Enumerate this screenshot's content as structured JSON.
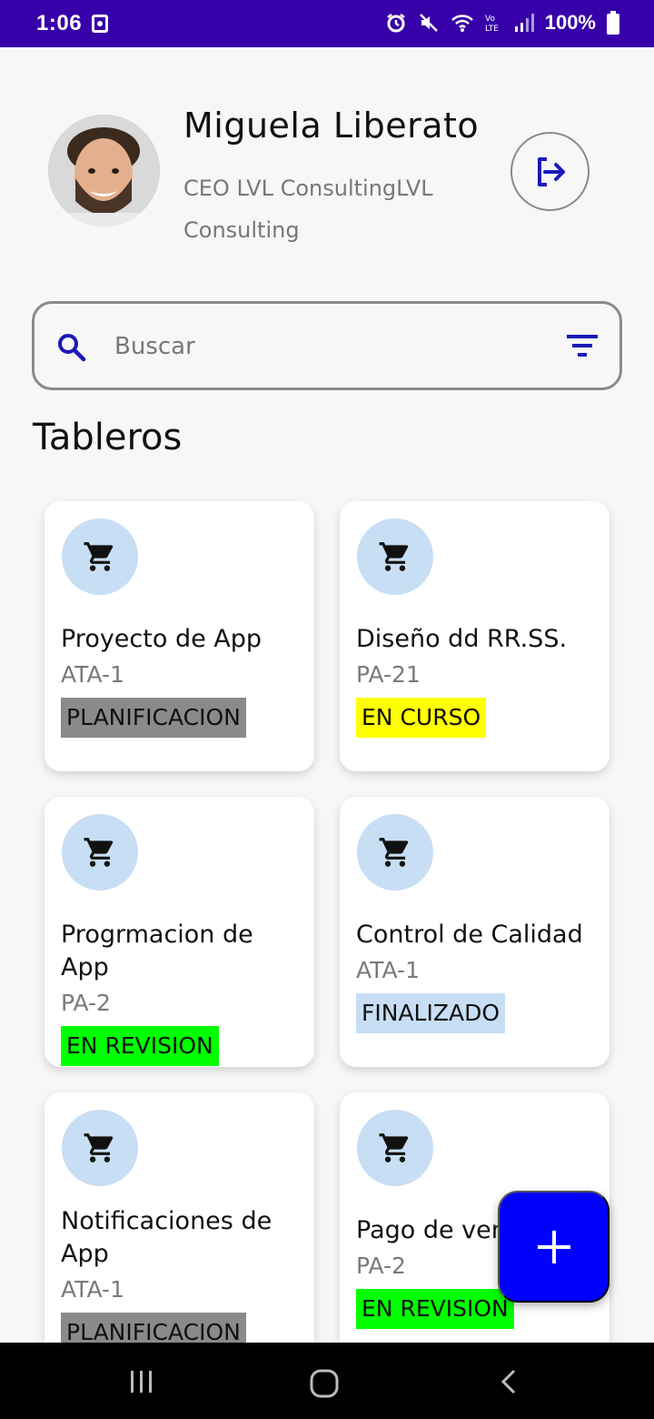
{
  "status_bar": {
    "time": "1:06",
    "battery": "100%"
  },
  "profile": {
    "name": "Miguela Liberato",
    "role": "CEO LVL ConsultingLVL Consulting"
  },
  "search": {
    "placeholder": "Buscar"
  },
  "section_title": "Tableros",
  "boards": [
    {
      "title": "Proyecto de App",
      "code": "ATA-1",
      "status": "PLANIFICACION",
      "status_color": "#8a8a8a"
    },
    {
      "title": "Diseño dd RR.SS.",
      "code": "PA-21",
      "status": "EN CURSO",
      "status_color": "#ffff00"
    },
    {
      "title": "Progrmacion de App",
      "code": "PA-2",
      "status": "EN REVISION",
      "status_color": "#00ff00"
    },
    {
      "title": "Control de Calidad",
      "code": "ATA-1",
      "status": "FINALIZADO",
      "status_color": "#c7def4"
    },
    {
      "title": "Notificaciones de App",
      "code": "ATA-1",
      "status": "PLANIFICACION",
      "status_color": "#8a8a8a"
    },
    {
      "title": "Pago de ventas",
      "code": "PA-2",
      "status": "EN REVISION",
      "status_color": "#00ff00"
    }
  ],
  "colors": {
    "status_bar": "#3800a8",
    "accent": "#0000ff",
    "icon": "#1a1ab8",
    "card_icon_bg": "#c7def4"
  },
  "icons": {
    "logout": "logout-icon",
    "search": "search-icon",
    "filter": "filter-icon",
    "board": "cart-icon",
    "fab": "plus-icon"
  }
}
